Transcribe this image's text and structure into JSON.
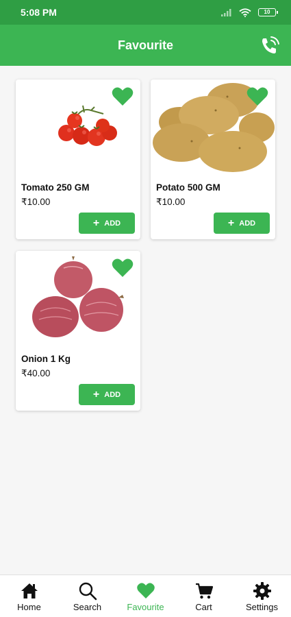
{
  "status_bar": {
    "time": "5:08 PM",
    "battery": "10"
  },
  "app_bar": {
    "title": "Favourite"
  },
  "products": [
    {
      "name": "Tomato 250 GM",
      "price": "₹10.00",
      "add_label": "ADD",
      "image": "tomato"
    },
    {
      "name": "Potato 500 GM",
      "price": "₹10.00",
      "add_label": "ADD",
      "image": "potato"
    },
    {
      "name": "Onion 1 Kg",
      "price": "₹40.00",
      "add_label": "ADD",
      "image": "onion"
    }
  ],
  "bottom_nav": [
    {
      "label": "Home",
      "icon": "home-icon",
      "active": false
    },
    {
      "label": "Search",
      "icon": "search-icon",
      "active": false
    },
    {
      "label": "Favourite",
      "icon": "heart-icon",
      "active": true
    },
    {
      "label": "Cart",
      "icon": "cart-icon",
      "active": false
    },
    {
      "label": "Settings",
      "icon": "gear-icon",
      "active": false
    }
  ],
  "colors": {
    "primary": "#3cb553",
    "status_bar": "#2f9e44"
  }
}
